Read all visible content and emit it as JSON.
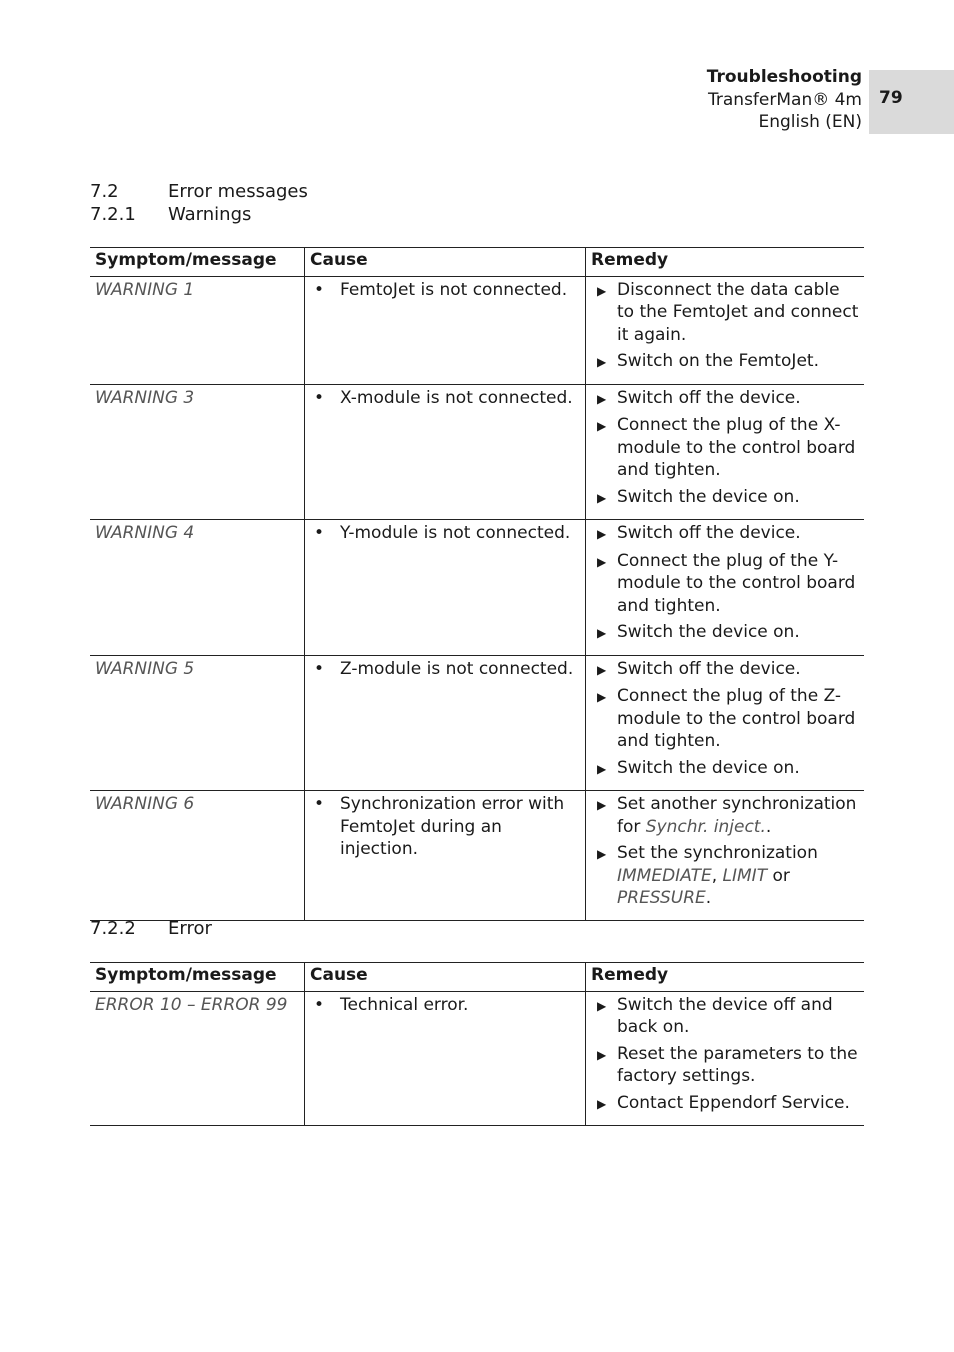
{
  "header": {
    "chapter": "Troubleshooting",
    "product": "TransferMan® 4m",
    "language": "English (EN)",
    "page_number": "79"
  },
  "sections": {
    "s72": {
      "num": "7.2",
      "title": "Error messages"
    },
    "s721": {
      "num": "7.2.1",
      "title": "Warnings"
    },
    "s722": {
      "num": "7.2.2",
      "title": "Error"
    }
  },
  "columns": {
    "symptom": "Symptom/message",
    "cause": "Cause",
    "remedy": "Remedy"
  },
  "warnings": [
    {
      "symptom": "WARNING 1",
      "cause": "FemtoJet is not connected.",
      "remedies": [
        "Disconnect the data cable to the FemtoJet and connect it again.",
        "Switch on the FemtoJet."
      ]
    },
    {
      "symptom": "WARNING 3",
      "cause": "X-module is not connected.",
      "remedies": [
        "Switch off the device.",
        "Connect the plug of the X-module to the control board and tighten.",
        "Switch the device on."
      ]
    },
    {
      "symptom": "WARNING 4",
      "cause": "Y-module is not connected.",
      "remedies": [
        "Switch off the device.",
        "Connect the plug of the Y-module to the control board and tighten.",
        "Switch the device on."
      ]
    },
    {
      "symptom": "WARNING 5",
      "cause": "Z-module is not connected.",
      "remedies": [
        "Switch off the device.",
        "Connect the plug of the Z-module to the control board and tighten.",
        "Switch the device on."
      ]
    },
    {
      "symptom": "WARNING 6",
      "cause": "Synchronization error with FemtoJet during an injection.",
      "remedy_rich": {
        "r1_pre": "Set another synchronization for ",
        "r1_it": "Synchr. inject.",
        "r1_post": ".",
        "r2_pre": "Set the synchronization ",
        "r2_it1": "IMMEDIATE",
        "r2_sep": ", ",
        "r2_it2": "LIMIT",
        "r2_mid": " or ",
        "r2_it3": "PRESSURE",
        "r2_post": "."
      }
    }
  ],
  "errors": [
    {
      "symptom": "ERROR 10 – ERROR 99",
      "cause": "Technical error.",
      "remedies": [
        "Switch the device off and back on.",
        "Reset the parameters to the factory settings.",
        "Contact Eppendorf Service."
      ]
    }
  ]
}
